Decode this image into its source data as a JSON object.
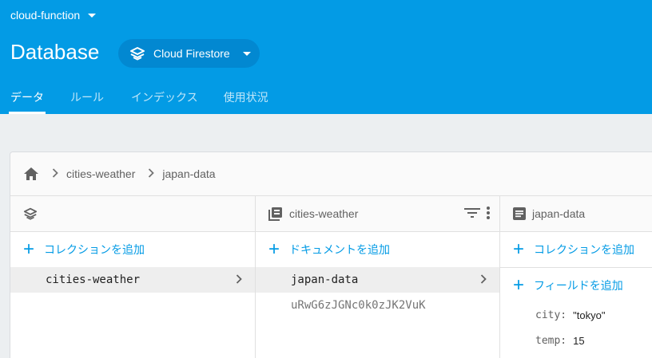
{
  "header": {
    "project_name": "cloud-function",
    "title": "Database",
    "db_selector": "Cloud Firestore",
    "tabs": [
      {
        "label": "データ"
      },
      {
        "label": "ルール"
      },
      {
        "label": "インデックス"
      },
      {
        "label": "使用状況"
      }
    ]
  },
  "breadcrumb": {
    "items": [
      "cities-weather",
      "japan-data"
    ]
  },
  "root_column": {
    "add_label": "コレクションを追加",
    "items": [
      {
        "label": "cities-weather"
      }
    ]
  },
  "collection_column": {
    "title": "cities-weather",
    "add_label": "ドキュメントを追加",
    "items": [
      {
        "label": "japan-data"
      },
      {
        "label": "uRwG6zJGNc0k0zJK2VuK"
      }
    ]
  },
  "document_column": {
    "title": "japan-data",
    "add_collection_label": "コレクションを追加",
    "add_field_label": "フィールドを追加",
    "fields": [
      {
        "key": "city:",
        "value": "\"tokyo\""
      },
      {
        "key": "temp:",
        "value": "15"
      }
    ]
  },
  "colors": {
    "brand": "#039be5",
    "header_dark": "#0288d1"
  }
}
